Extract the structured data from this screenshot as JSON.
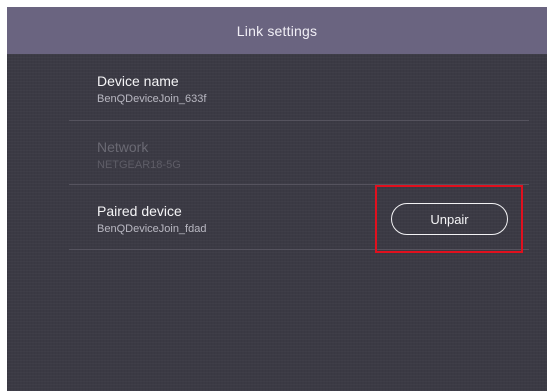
{
  "header": {
    "title": "Link settings"
  },
  "settings": {
    "device_name": {
      "label": "Device name",
      "value": "BenQDeviceJoin_633f"
    },
    "network": {
      "label": "Network",
      "value": "NETGEAR18-5G",
      "disabled": true
    },
    "paired_device": {
      "label": "Paired device",
      "value": "BenQDeviceJoin_fdad"
    }
  },
  "buttons": {
    "unpair_label": "Unpair"
  },
  "colors": {
    "header_bg": "#6a6480",
    "screen_bg": "#3b3a44",
    "highlight": "#e0101e"
  }
}
